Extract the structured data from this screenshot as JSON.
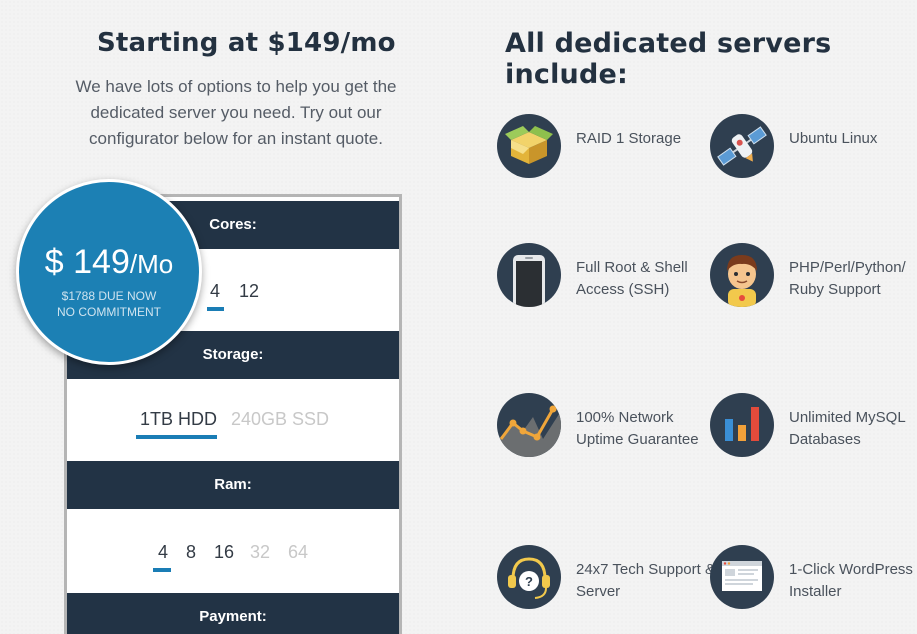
{
  "left": {
    "heading": "Starting at $149/mo",
    "intro": "We have lots of options to help you get the dedicated server you need. Try out our configurator below for an instant quote."
  },
  "price": {
    "amount": "$ 149",
    "per": "/Mo",
    "due": "$1788 DUE NOW",
    "commitment": "NO COMMITMENT"
  },
  "configurator": {
    "cores": {
      "label": "Cores:",
      "options": [
        "4",
        "12"
      ],
      "selected": "4"
    },
    "storage": {
      "label": "Storage:",
      "options": [
        "1TB HDD",
        "240GB SSD"
      ],
      "selected": "1TB HDD"
    },
    "ram": {
      "label": "Ram:",
      "options": [
        "4",
        "8",
        "16",
        "32",
        "64"
      ],
      "selected": "4",
      "disabled": [
        "32",
        "64"
      ]
    },
    "payment": {
      "label": "Payment:"
    }
  },
  "features": {
    "heading": "All dedicated servers include:",
    "items": [
      {
        "icon": "storage-box-icon",
        "label": "RAID 1 Storage"
      },
      {
        "icon": "satellite-icon",
        "label": "Ubuntu Linux"
      },
      {
        "icon": "smartphone-icon",
        "label": "Full Root & Shell Access (SSH)"
      },
      {
        "icon": "developer-avatar-icon",
        "label": "PHP/Perl/Python/ Ruby Support"
      },
      {
        "icon": "uptime-graph-icon",
        "label": "100% Network Uptime Guarantee"
      },
      {
        "icon": "bar-chart-icon",
        "label": "Unlimited MySQL Databases"
      },
      {
        "icon": "headset-support-icon",
        "label": "24x7 Tech Support & Server"
      },
      {
        "icon": "browser-window-icon",
        "label": "1-Click WordPress Installer"
      }
    ]
  },
  "colors": {
    "navy": "#223345",
    "accent": "#1c80b4",
    "text": "#4a525c"
  }
}
